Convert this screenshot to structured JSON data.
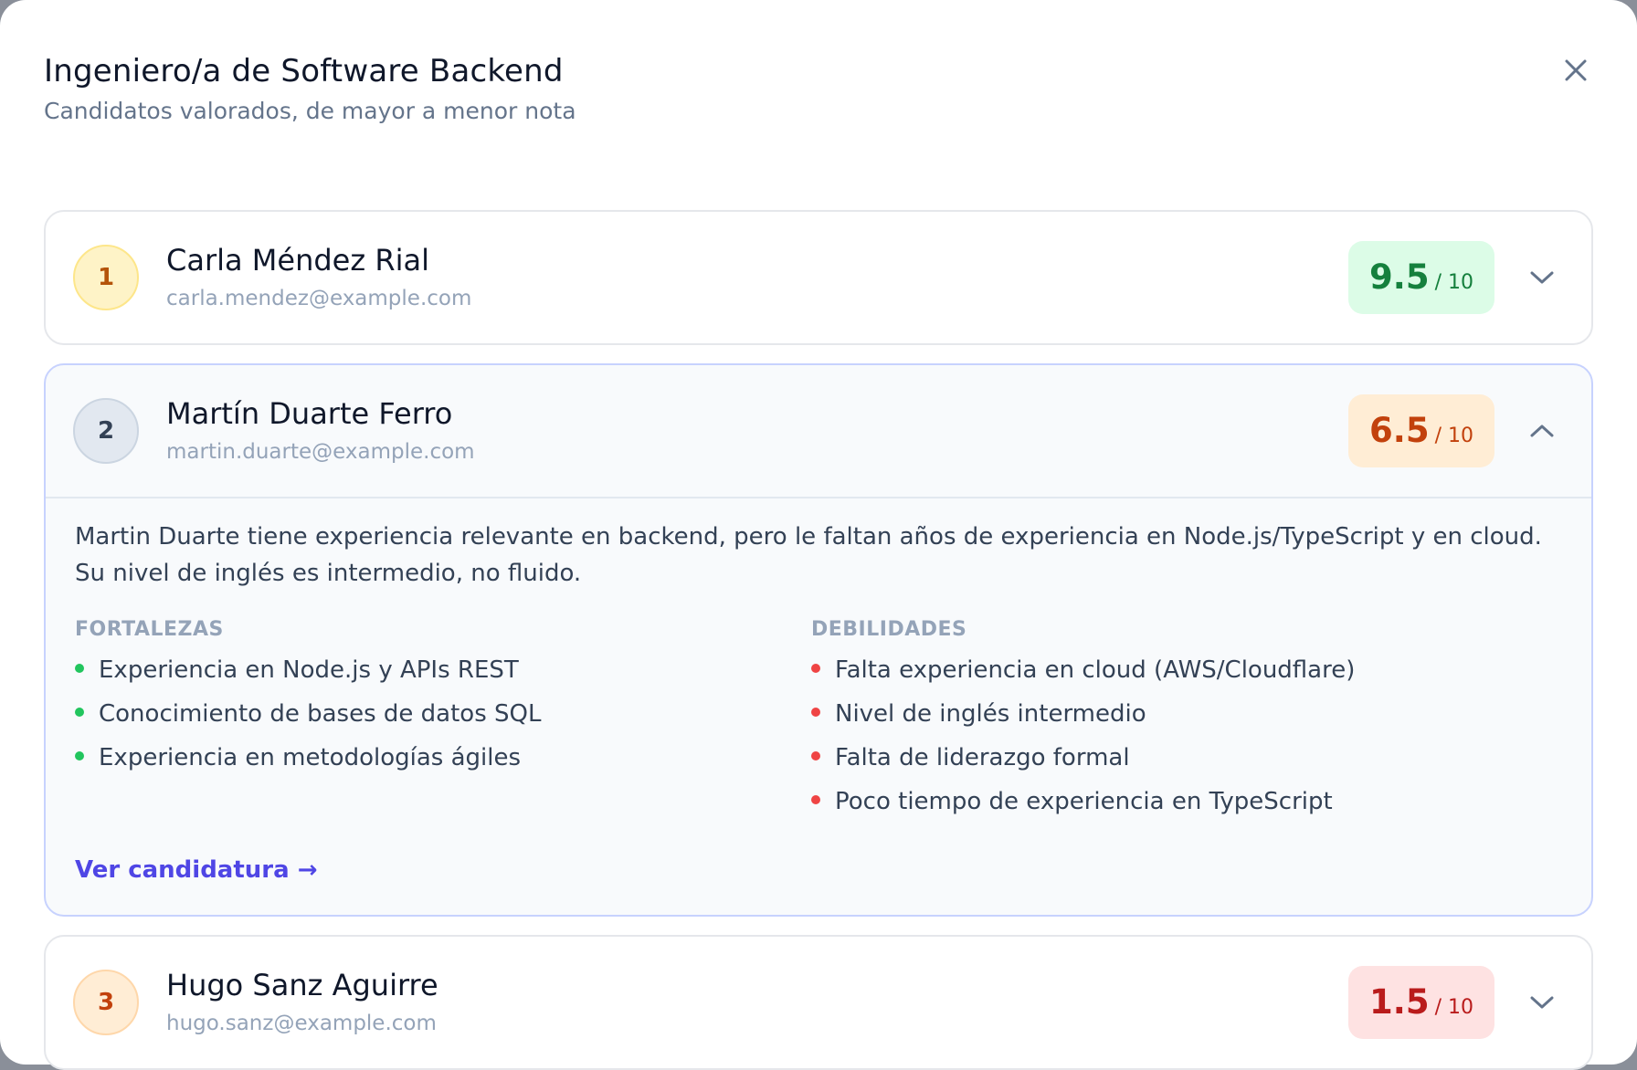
{
  "modal": {
    "title": "Ingeniero/a de Software Backend",
    "subtitle": "Candidatos valorados, de mayor a menor nota",
    "close_icon": "close-icon"
  },
  "colors": {
    "accent": "#4f46e5",
    "score_high": "#15803d",
    "score_mid": "#c2410c",
    "score_low": "#b91c1c",
    "strength_dot": "#22c55e",
    "weakness_dot": "#ef4444"
  },
  "candidates": [
    {
      "rank": "1",
      "name": "Carla Méndez Rial",
      "email": "carla.mendez@example.com",
      "score": "9.5",
      "score_max": "/ 10",
      "expanded": false,
      "chevron_icon": "chevron-down-icon"
    },
    {
      "rank": "2",
      "name": "Martín Duarte Ferro",
      "email": "martin.duarte@example.com",
      "score": "6.5",
      "score_max": "/ 10",
      "expanded": true,
      "chevron_icon": "chevron-up-icon",
      "summary": "Martin Duarte tiene experiencia relevante en backend, pero le faltan años de experiencia en Node.js/TypeScript y en cloud. Su nivel de inglés es intermedio, no fluido.",
      "strengths_title": "Fortalezas",
      "strengths": [
        "Experiencia en Node.js y APIs REST",
        "Conocimiento de bases de datos SQL",
        "Experiencia en metodologías ágiles"
      ],
      "weaknesses_title": "Debilidades",
      "weaknesses": [
        "Falta experiencia en cloud (AWS/Cloudflare)",
        "Nivel de inglés intermedio",
        "Falta de liderazgo formal",
        "Poco tiempo de experiencia en TypeScript"
      ],
      "link_label": "Ver candidatura →"
    },
    {
      "rank": "3",
      "name": "Hugo Sanz Aguirre",
      "email": "hugo.sanz@example.com",
      "score": "1.5",
      "score_max": "/ 10",
      "expanded": false,
      "chevron_icon": "chevron-down-icon"
    }
  ]
}
